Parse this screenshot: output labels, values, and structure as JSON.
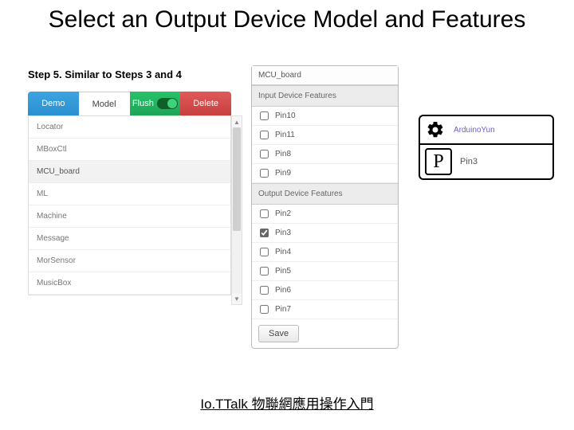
{
  "title": "Select an Output Device Model and Features",
  "step_text": "Step 5. Similar to Steps 3 and 4",
  "tabs": {
    "demo": "Demo",
    "model": "Model",
    "flush": "Flush",
    "delete": "Delete"
  },
  "model_list": [
    "Locator",
    "MBoxCtl",
    "MCU_board",
    "ML",
    "Machine",
    "Message",
    "MorSensor",
    "MusicBox"
  ],
  "selected_model_index": 2,
  "features": {
    "device_name": "MCU_board",
    "input_section": "Input Device Features",
    "input_items": [
      {
        "label": "Pin10",
        "checked": false
      },
      {
        "label": "Pin11",
        "checked": false
      },
      {
        "label": "Pin8",
        "checked": false
      },
      {
        "label": "Pin9",
        "checked": false
      }
    ],
    "output_section": "Output Device Features",
    "output_items": [
      {
        "label": "Pin2",
        "checked": false
      },
      {
        "label": "Pin3",
        "checked": true
      },
      {
        "label": "Pin4",
        "checked": false
      },
      {
        "label": "Pin5",
        "checked": false
      },
      {
        "label": "Pin6",
        "checked": false
      },
      {
        "label": "Pin7",
        "checked": false
      }
    ],
    "save_label": "Save"
  },
  "device_box": {
    "primary": "ArduinoYun",
    "selected_pin": "Pin3",
    "p_glyph": "P"
  },
  "footer": "Io.TTalk 物聯網應用操作入門"
}
